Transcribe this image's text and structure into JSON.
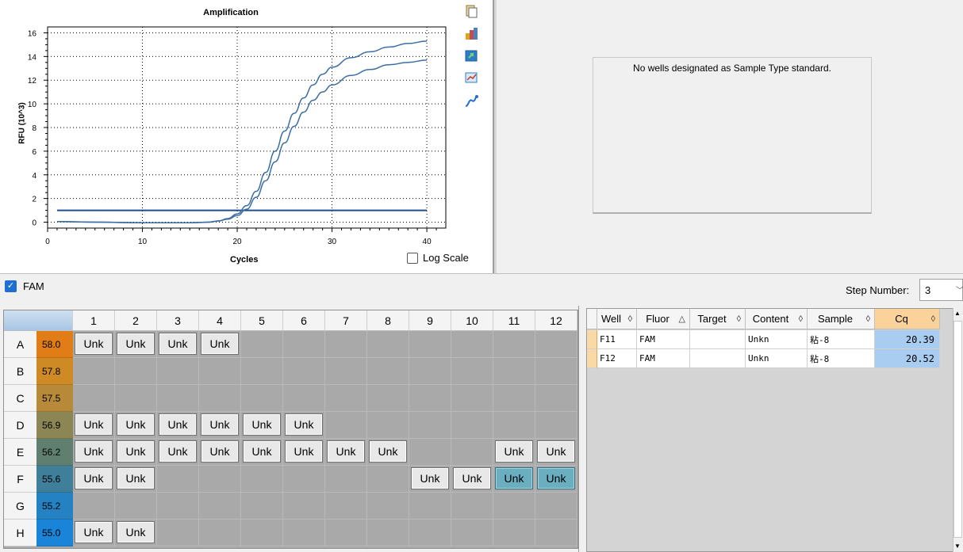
{
  "chart": {
    "title": "Amplification",
    "ylabel": "RFU (10^3)",
    "xlabel": "Cycles",
    "log_scale_label": "Log Scale",
    "log_scale_checked": false
  },
  "chart_data": {
    "type": "line",
    "title": "Amplification",
    "xlabel": "Cycles",
    "ylabel": "RFU (10^3)",
    "xlim": [
      0,
      42
    ],
    "ylim": [
      -0.5,
      16.5
    ],
    "x_ticks": [
      0,
      10,
      20,
      30,
      40
    ],
    "y_ticks": [
      0,
      2,
      4,
      6,
      8,
      10,
      12,
      14,
      16
    ],
    "grid": true,
    "threshold": 1.0,
    "series": [
      {
        "values": [
          [
            1,
            0.05
          ],
          [
            5,
            0.0
          ],
          [
            10,
            -0.05
          ],
          [
            15,
            -0.05
          ],
          [
            17,
            0.0
          ],
          [
            18,
            0.1
          ],
          [
            19,
            0.3
          ],
          [
            20,
            0.7
          ],
          [
            21,
            1.4
          ],
          [
            22,
            2.6
          ],
          [
            23,
            4.2
          ],
          [
            24,
            6.0
          ],
          [
            25,
            7.7
          ],
          [
            26,
            9.2
          ],
          [
            27,
            10.5
          ],
          [
            28,
            11.6
          ],
          [
            29,
            12.5
          ],
          [
            30,
            13.1
          ],
          [
            32,
            13.9
          ],
          [
            34,
            14.4
          ],
          [
            36,
            14.8
          ],
          [
            38,
            15.1
          ],
          [
            40,
            15.3
          ]
        ]
      },
      {
        "values": [
          [
            1,
            0.05
          ],
          [
            5,
            0.0
          ],
          [
            10,
            -0.05
          ],
          [
            15,
            -0.05
          ],
          [
            17,
            0.0
          ],
          [
            18,
            0.1
          ],
          [
            19,
            0.25
          ],
          [
            20,
            0.55
          ],
          [
            21,
            1.1
          ],
          [
            22,
            2.1
          ],
          [
            23,
            3.5
          ],
          [
            24,
            5.1
          ],
          [
            25,
            6.7
          ],
          [
            26,
            8.1
          ],
          [
            27,
            9.3
          ],
          [
            28,
            10.3
          ],
          [
            29,
            11.0
          ],
          [
            30,
            11.6
          ],
          [
            32,
            12.4
          ],
          [
            34,
            12.9
          ],
          [
            36,
            13.3
          ],
          [
            38,
            13.5
          ],
          [
            40,
            13.7
          ]
        ]
      }
    ]
  },
  "toolbar_icons": [
    "copy-icon",
    "chart-color-icon",
    "export-icon",
    "zoom-icon",
    "curve-icon"
  ],
  "standard_panel": {
    "message": "No wells designated as Sample Type standard."
  },
  "fluor_bar": {
    "fluor_label": "FAM",
    "fluor_checked": true,
    "step_label": "Step Number:",
    "step_value": "3"
  },
  "plate": {
    "columns": [
      "1",
      "2",
      "3",
      "4",
      "5",
      "6",
      "7",
      "8",
      "9",
      "10",
      "11",
      "12"
    ],
    "rows": [
      {
        "label": "A",
        "temp": "58.0",
        "temp_color": "#e07d17",
        "wells": [
          "Unk",
          "Unk",
          "Unk",
          "Unk",
          "",
          "",
          "",
          "",
          "",
          "",
          "",
          ""
        ]
      },
      {
        "label": "B",
        "temp": "57.8",
        "temp_color": "#cd8a25",
        "wells": [
          "",
          "",
          "",
          "",
          "",
          "",
          "",
          "",
          "",
          "",
          "",
          ""
        ]
      },
      {
        "label": "C",
        "temp": "57.5",
        "temp_color": "#b78a3a",
        "wells": [
          "",
          "",
          "",
          "",
          "",
          "",
          "",
          "",
          "",
          "",
          "",
          ""
        ]
      },
      {
        "label": "D",
        "temp": "56.9",
        "temp_color": "#8c8654",
        "wells": [
          "Unk",
          "Unk",
          "Unk",
          "Unk",
          "Unk",
          "Unk",
          "",
          "",
          "",
          "",
          "",
          ""
        ]
      },
      {
        "label": "E",
        "temp": "56.2",
        "temp_color": "#5f8070",
        "wells": [
          "Unk",
          "Unk",
          "Unk",
          "Unk",
          "Unk",
          "Unk",
          "Unk",
          "Unk",
          "",
          "",
          "Unk",
          "Unk"
        ]
      },
      {
        "label": "F",
        "temp": "55.6",
        "temp_color": "#3f7f9a",
        "wells": [
          "Unk",
          "Unk",
          "",
          "",
          "",
          "",
          "",
          "",
          "Unk",
          "Unk",
          "Unk*",
          "Unk*"
        ]
      },
      {
        "label": "G",
        "temp": "55.2",
        "temp_color": "#2481c2",
        "wells": [
          "",
          "",
          "",
          "",
          "",
          "",
          "",
          "",
          "",
          "",
          "",
          ""
        ]
      },
      {
        "label": "H",
        "temp": "55.0",
        "temp_color": "#1a84d8",
        "wells": [
          "Unk",
          "Unk",
          "",
          "",
          "",
          "",
          "",
          "",
          "",
          "",
          "",
          ""
        ]
      }
    ]
  },
  "results_table": {
    "headers": [
      "Well",
      "Fluor",
      "Target",
      "Content",
      "Sample",
      "Cq"
    ],
    "rows": [
      {
        "well": "F11",
        "fluor": "FAM",
        "target": "",
        "content": "Unkn",
        "sample": "粘-8",
        "cq": "20.39"
      },
      {
        "well": "F12",
        "fluor": "FAM",
        "target": "",
        "content": "Unkn",
        "sample": "粘-8",
        "cq": "20.52"
      }
    ]
  }
}
